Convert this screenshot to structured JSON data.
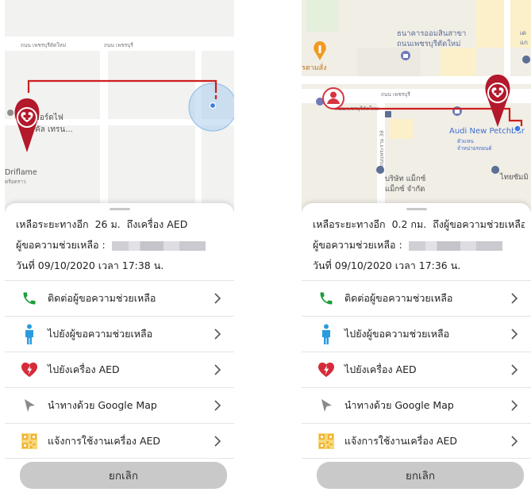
{
  "screens": [
    {
      "id": "left",
      "map": {
        "street_labels": [
          "ถนน เพชรบุรีตัดใหม่",
          "ถนน เพชรบุรี"
        ],
        "place_labels": [
          "ยอร์ดไฟ",
          "คัล เทรน...",
          "Driflame",
          "ตร้อตราว"
        ]
      },
      "info": {
        "distance_prefix": "เหลือระยะทางอีก",
        "distance_value": "26 ม.",
        "distance_suffix": "ถึงเครื่อง AED",
        "requester_label": "ผู้ขอความช่วยเหลือ :",
        "datetime": "วันที่ 09/10/2020 เวลา 17:38 น."
      },
      "actions": [
        {
          "label": "ติดต่อผู้ขอความช่วยเหลือ",
          "icon": "phone-icon"
        },
        {
          "label": "ไปยังผู้ขอความช่วยเหลือ",
          "icon": "person-icon"
        },
        {
          "label": "ไปยังเครื่อง AED",
          "icon": "heart-defibrillator-icon"
        },
        {
          "label": "นำทางด้วย Google Map",
          "icon": "navigation-arrow-icon"
        },
        {
          "label": "แจ้งการใช้งานเครื่อง AED",
          "icon": "qr-code-icon"
        }
      ],
      "cancel_label": "ยกเลิก"
    },
    {
      "id": "right",
      "map": {
        "street_labels": [
          "ถนน เพชรบุรี",
          "ถนนเพชรบุรีตัดใหม่",
          "ถนนพระราม 38"
        ],
        "place_labels": [
          "ธนาคารออมสินสาขา",
          "ถนนเพชรบุรีตัดใหม่",
          "รตามสั่ง",
          "Audi New Petchbur",
          "ตัวแทน",
          "จำหน่ายรถยนต์",
          "บริษัท แม็กซ์",
          "แม็กซ์ จำกัด",
          "ไทยซัมมิ",
          "เด",
          "แก"
        ]
      },
      "info": {
        "distance_prefix": "เหลือระยะทางอีก",
        "distance_value": "0.2 กม.",
        "distance_suffix": "ถึงผู้ขอความช่วยเหลือ",
        "requester_label": "ผู้ขอความช่วยเหลือ :",
        "datetime": "วันที่ 09/10/2020 เวลา 17:36 น."
      },
      "actions": [
        {
          "label": "ติดต่อผู้ขอความช่วยเหลือ",
          "icon": "phone-icon"
        },
        {
          "label": "ไปยังผู้ขอความช่วยเหลือ",
          "icon": "person-icon"
        },
        {
          "label": "ไปยังเครื่อง AED",
          "icon": "heart-defibrillator-icon"
        },
        {
          "label": "นำทางด้วย Google Map",
          "icon": "navigation-arrow-icon"
        },
        {
          "label": "แจ้งการใช้งานเครื่อง AED",
          "icon": "qr-code-icon"
        }
      ],
      "cancel_label": "ยกเลิก"
    }
  ],
  "colors": {
    "route": "#cc1f1f",
    "marker_red": "#b3182b",
    "phone_green": "#1e9e3a",
    "person_blue": "#2b9be0",
    "heart_red": "#d62b3a",
    "qr_orange": "#f2b233",
    "location_dot": "#3c7be0",
    "cancel_bg": "#c9c9c9"
  }
}
